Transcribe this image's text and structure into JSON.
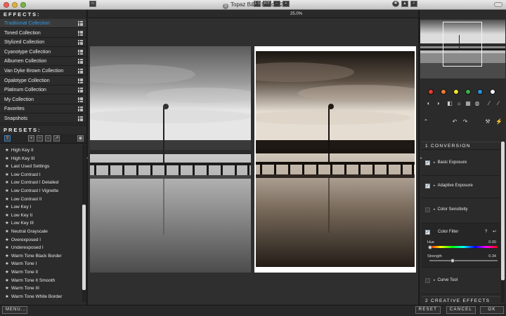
{
  "window": {
    "title": "Topaz B&W Effects 2"
  },
  "effects": {
    "header": "EFFECTS:",
    "collections": [
      "Traditional Collection",
      "Toned Collection",
      "Stylized Collection",
      "Cyanotype Collection",
      "Albumen Collection",
      "Van Dyke Brown Collection",
      "Opalotype Collection",
      "Platinum Collection",
      "My Collection",
      "Favorites",
      "Snapshots"
    ],
    "active_index": 0,
    "active_color": "#2e9be6"
  },
  "presets": {
    "header": "PRESETS:",
    "items": [
      "High Key II",
      "High Key III",
      "Last Used Settings",
      "Low Contrast I",
      "Low Contrast I Detailed",
      "Low Contrast I Vignette",
      "Low Contrast II",
      "Low Key I",
      "Low Key II",
      "Low Key III",
      "Neutral Grayscale",
      "Overexposed I",
      "Underexposed I",
      "Warm Tone Black Border",
      "Warm Tone I",
      "Warm Tone II",
      "Warm Tone II Smooth",
      "Warm Tone III",
      "Warm Tone White Border"
    ]
  },
  "toolbar": {
    "zoom_1to1": "1:1",
    "zoom_fit": "FIT",
    "zoom_level": "25.0%"
  },
  "colors": {
    "swatches": [
      "#e8392b",
      "#f07b2b",
      "#f2e22a",
      "#3bb04b",
      "#2e8fd8",
      "#f2f2f2"
    ]
  },
  "adjustments": {
    "section_title": "1  CONVERSION",
    "basic_exposure": "Basic Exposure",
    "adaptive_exposure": "Adaptive Exposure",
    "color_sensitivity": "Color Sensitivity",
    "color_filter": "Color Filter",
    "help": "?",
    "hue_label": "Hue",
    "hue_value": "0.00",
    "hue_level": 0.0,
    "strength_label": "Strength",
    "strength_value": "0.34",
    "strength_level": 0.34,
    "curve_tool": "Curve Tool",
    "next_section": "2  CREATIVE EFFECTS"
  },
  "bottom": {
    "menu": "MENU...",
    "reset": "RESET",
    "cancel": "CANCEL",
    "ok": "OK"
  }
}
